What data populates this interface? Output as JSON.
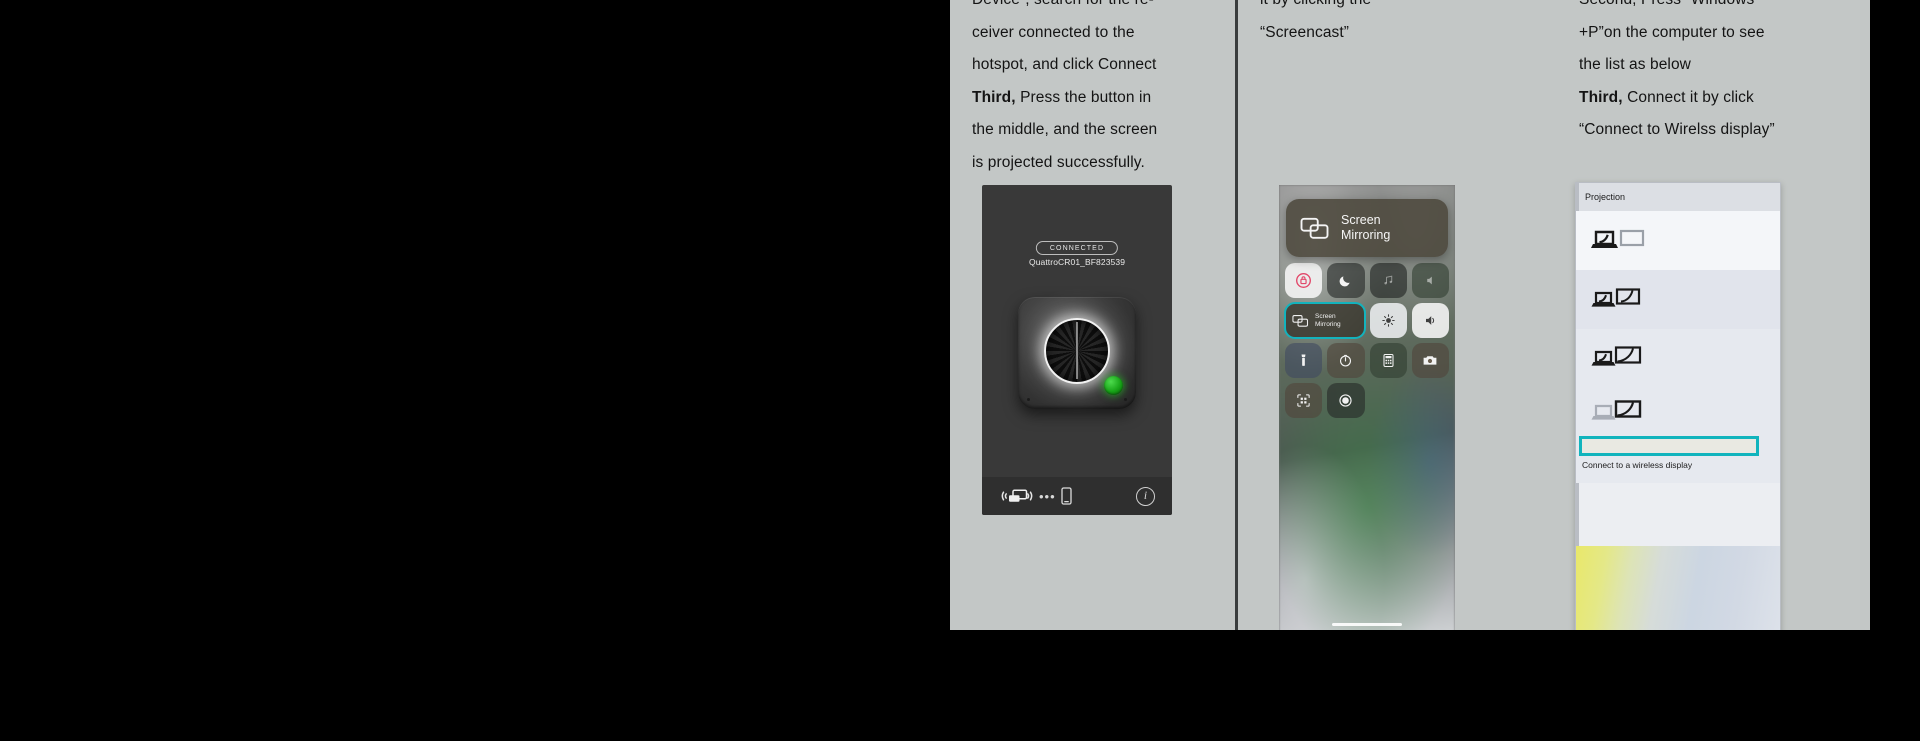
{
  "document": {
    "background_color": "#000000",
    "page_color": "#c3c7c6",
    "accent_color": "#11b4bd"
  },
  "columns": {
    "left": {
      "instructions": [
        {
          "clipped": true,
          "text": "Device”, search for the re-"
        },
        {
          "clipped": false,
          "text": "ceiver connected to the"
        },
        {
          "clipped": false,
          "text": "hotspot, and click Connect"
        },
        {
          "clipped": false,
          "bold_prefix": "Third,",
          "text": " Press the button in"
        },
        {
          "clipped": false,
          "text": "the middle, and the screen"
        },
        {
          "clipped": false,
          "text": "is projected successfully."
        }
      ],
      "device_card": {
        "status_badge": "CONNECTED",
        "device_name": "QuattroCR01_BF823539",
        "led_color": "#1ea81e",
        "footer": {
          "cast_icon": "screen-cast-icon",
          "dots": "•••",
          "phone_icon": "mobile-phone-icon",
          "info_label": "i"
        }
      }
    },
    "middle": {
      "instructions": [
        {
          "clipped": true,
          "text": "it by clicking the"
        },
        {
          "clipped": false,
          "text": "“Screencast”"
        }
      ],
      "control_center": {
        "popup": {
          "icon": "screen-mirroring-icon",
          "label": "Screen\nMirroring"
        },
        "tiles": [
          {
            "name": "rotation-lock",
            "icon": "rotation-lock-icon",
            "style": "pale"
          },
          {
            "name": "do-not-disturb",
            "icon": "moon-icon",
            "style": "dark"
          },
          {
            "name": "media-playback",
            "icon": "music-icon",
            "style": "dark2"
          },
          {
            "name": "volume-slider",
            "icon": "speaker-icon",
            "style": "greenish"
          },
          {
            "name": "screen-mirroring",
            "icon": "screen-mirroring-icon",
            "label": "Screen\nMirroring",
            "style": "highlighted",
            "span": 2
          },
          {
            "name": "brightness-slider",
            "icon": "brightness-icon",
            "style": "pale2"
          },
          {
            "name": "volume-control",
            "icon": "volume-icon",
            "style": "pale"
          },
          {
            "name": "flashlight",
            "icon": "flashlight-icon",
            "style": "blueish"
          },
          {
            "name": "timer",
            "icon": "timer-icon",
            "style": "brownish"
          },
          {
            "name": "calculator",
            "icon": "calculator-icon",
            "style": "greenish"
          },
          {
            "name": "camera",
            "icon": "camera-icon",
            "style": "brownish"
          },
          {
            "name": "qr-scanner",
            "icon": "qr-code-icon",
            "style": "brownish"
          },
          {
            "name": "screen-recording",
            "icon": "record-icon",
            "style": "dark"
          }
        ]
      }
    },
    "right": {
      "instructions": [
        {
          "clipped": true,
          "text": "Second, Press “Windows"
        },
        {
          "clipped": false,
          "text": "+P”on the computer to see"
        },
        {
          "clipped": false,
          "text": "the list as below"
        },
        {
          "clipped": false,
          "bold_prefix": "Third,",
          "text": " Connect it by click"
        },
        {
          "clipped": false,
          "text": "“Connect to Wirelss display”"
        }
      ],
      "projection_panel": {
        "title": "Projection",
        "options": [
          {
            "name": "pc-screen-only",
            "icon": "pc-screen-only-icon",
            "selected": true
          },
          {
            "name": "duplicate",
            "icon": "duplicate-display-icon",
            "selected": false
          },
          {
            "name": "extend",
            "icon": "extend-display-icon",
            "selected": false
          }
        ],
        "wireless": {
          "icon": "second-screen-only-icon",
          "label": "Connect to a wireless display",
          "highlight_color": "#11b4bd"
        }
      }
    }
  }
}
